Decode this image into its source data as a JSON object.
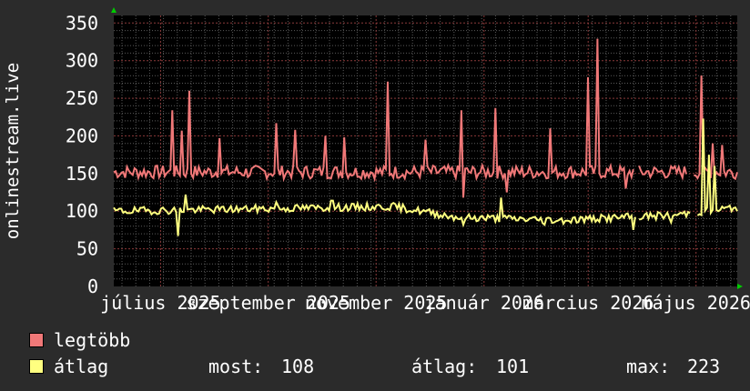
{
  "chart_data": {
    "type": "line",
    "ylabel": "onlinestream.live",
    "yticks": [
      0,
      50,
      100,
      150,
      200,
      250,
      300,
      350
    ],
    "ylim": [
      0,
      360
    ],
    "xlim": [
      0,
      1
    ],
    "xticks": [
      {
        "label": "július 2025",
        "x": 0.075
      },
      {
        "label": "szeptember 2025",
        "x": 0.2478
      },
      {
        "label": "november 2025",
        "x": 0.4208
      },
      {
        "label": "január 2026",
        "x": 0.5938
      },
      {
        "label": "március 2026",
        "x": 0.7609
      },
      {
        "label": "május 2026",
        "x": 0.9339
      }
    ],
    "grid": true,
    "series": [
      {
        "name": "legtöbb",
        "color": "#f07878",
        "base": 152,
        "noise": 9,
        "seed": 7,
        "gaps": [
          [
            0.835,
            0.842
          ],
          [
            0.92,
            0.93
          ]
        ],
        "spikes": [
          [
            0.094,
            234
          ],
          [
            0.11,
            207
          ],
          [
            0.122,
            260
          ],
          [
            0.17,
            197
          ],
          [
            0.262,
            217
          ],
          [
            0.29,
            208
          ],
          [
            0.34,
            200
          ],
          [
            0.37,
            198
          ],
          [
            0.44,
            272
          ],
          [
            0.5,
            195
          ],
          [
            0.557,
            234
          ],
          [
            0.612,
            237
          ],
          [
            0.7,
            210
          ],
          [
            0.76,
            278
          ],
          [
            0.777,
            329
          ],
          [
            0.943,
            280
          ],
          [
            0.96,
            190
          ],
          [
            0.975,
            188
          ]
        ],
        "dips": [
          [
            0.56,
            118
          ],
          [
            0.63,
            125
          ],
          [
            0.82,
            130
          ]
        ]
      },
      {
        "name": "átlag",
        "color": "#ffff80",
        "base": 100,
        "noise": 5,
        "seed": 19,
        "gaps": [
          [
            0.838,
            0.842
          ],
          [
            0.925,
            0.935
          ]
        ],
        "spikes": [
          [
            0.116,
            122
          ],
          [
            0.26,
            112
          ],
          [
            0.35,
            114
          ],
          [
            0.62,
            118
          ],
          [
            0.945,
            223
          ],
          [
            0.955,
            175
          ],
          [
            0.965,
            160
          ]
        ],
        "dips": [
          [
            0.104,
            67
          ],
          [
            0.56,
            82
          ],
          [
            0.69,
            82
          ],
          [
            0.834,
            75
          ],
          [
            0.895,
            85
          ]
        ],
        "trend": [
          [
            0.0,
            100
          ],
          [
            0.45,
            106
          ],
          [
            0.55,
            92
          ],
          [
            0.72,
            88
          ],
          [
            0.9,
            95
          ],
          [
            1.0,
            105
          ]
        ]
      }
    ]
  },
  "legend": {
    "items": [
      {
        "label": "legtöbb",
        "color": "#f07878"
      },
      {
        "label": "átlag",
        "color": "#ffff80"
      }
    ],
    "stats": {
      "most_label": "most:",
      "most_value": "108",
      "atlag_label": "átlag:",
      "atlag_value": "101",
      "max_label": "max:",
      "max_value": "223"
    }
  }
}
